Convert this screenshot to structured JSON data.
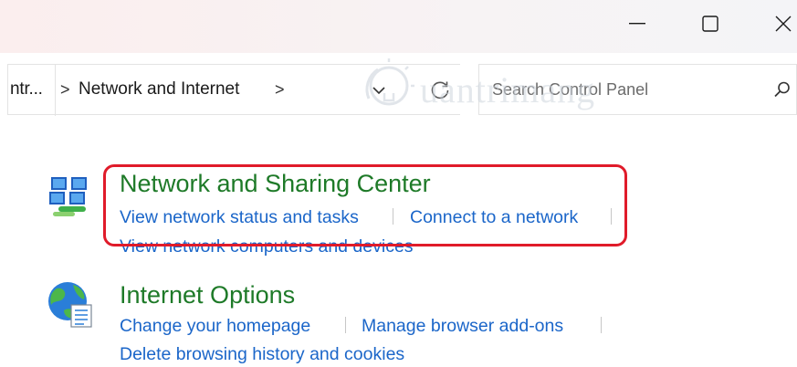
{
  "window": {
    "minimize_label": "Minimize",
    "maximize_label": "Maximize",
    "close_label": "Close"
  },
  "address_bar": {
    "truncated_crumb": "ntr...",
    "current_crumb": "Network and Internet",
    "separator": ">"
  },
  "search": {
    "placeholder": "Search Control Panel"
  },
  "watermark": {
    "text": "uantrimang"
  },
  "categories": [
    {
      "title": "Network and Sharing Center",
      "icon": "network-sharing-icon",
      "tasks": [
        "View network status and tasks",
        "Connect to a network",
        "View network computers and devices"
      ]
    },
    {
      "title": "Internet Options",
      "icon": "internet-options-icon",
      "tasks": [
        "Change your homepage",
        "Manage browser add-ons",
        "Delete browsing history and cookies"
      ]
    }
  ],
  "colors": {
    "category_title": "#1e7a28",
    "task_link": "#1b66c9",
    "highlight_border": "#e01b2a"
  }
}
